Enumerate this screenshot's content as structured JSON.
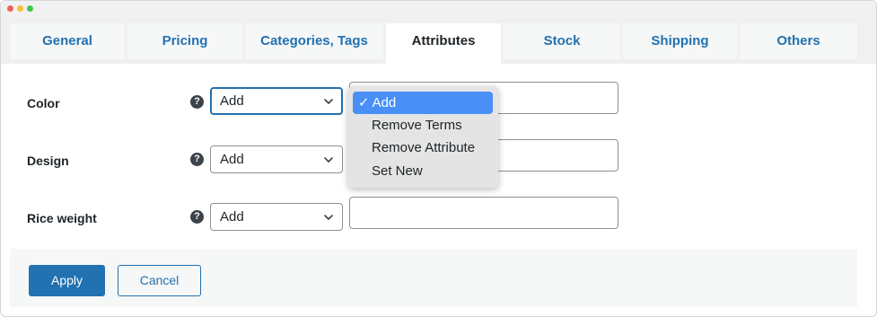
{
  "tabs": [
    {
      "label": "General"
    },
    {
      "label": "Pricing"
    },
    {
      "label": "Categories, Tags"
    },
    {
      "label": "Attributes",
      "active": true
    },
    {
      "label": "Stock"
    },
    {
      "label": "Shipping"
    },
    {
      "label": "Others"
    }
  ],
  "attributes": [
    {
      "label": "Color",
      "help_icon": "?",
      "action": "Add",
      "value": ""
    },
    {
      "label": "Design",
      "help_icon": "?",
      "action": "Add",
      "value": ""
    },
    {
      "label": "Rice weight",
      "help_icon": "?",
      "action": "Add",
      "value": ""
    }
  ],
  "dropdown": {
    "check": "✓",
    "options": [
      "Add",
      "Remove Terms",
      "Remove Attribute",
      "Set New"
    ],
    "selected": "Add"
  },
  "footer": {
    "apply_label": "Apply",
    "cancel_label": "Cancel"
  },
  "colors": {
    "accent": "#2271b1",
    "dropdown_highlight": "#4a8ff8"
  }
}
